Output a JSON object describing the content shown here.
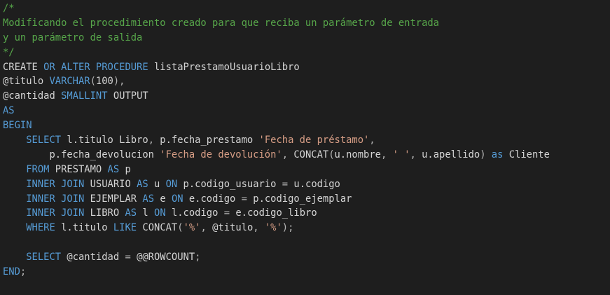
{
  "colors": {
    "background": "#1e1e1e",
    "comment": "#57a64a",
    "keyword": "#569cd6",
    "text": "#d4d4d4",
    "string": "#d69d85",
    "operator": "#b4b4b4"
  },
  "lines": [
    [
      {
        "t": "/*",
        "c": "comment"
      }
    ],
    [
      {
        "t": "Modificando el procedimiento creado para que reciba un parámetro de entrada",
        "c": "comment"
      }
    ],
    [
      {
        "t": "y un parámetro de salida",
        "c": "comment"
      }
    ],
    [
      {
        "t": "*/",
        "c": "comment"
      }
    ],
    [
      {
        "t": "CREATE ",
        "c": "text"
      },
      {
        "t": "OR ALTER PROCEDURE",
        "c": "keyword"
      },
      {
        "t": " listaPrestamoUsuarioLibro",
        "c": "text"
      }
    ],
    [
      {
        "t": "@titulo ",
        "c": "text"
      },
      {
        "t": "VARCHAR",
        "c": "keyword"
      },
      {
        "t": "(",
        "c": "op"
      },
      {
        "t": "100",
        "c": "text"
      },
      {
        "t": "),",
        "c": "op"
      }
    ],
    [
      {
        "t": "@cantidad ",
        "c": "text"
      },
      {
        "t": "SMALLINT",
        "c": "keyword"
      },
      {
        "t": " OUTPUT",
        "c": "text"
      }
    ],
    [
      {
        "t": "AS",
        "c": "keyword"
      }
    ],
    [
      {
        "t": "BEGIN",
        "c": "keyword"
      }
    ],
    [
      {
        "t": "    ",
        "c": "text"
      },
      {
        "t": "SELECT",
        "c": "keyword"
      },
      {
        "t": " l.titulo Libro",
        "c": "text"
      },
      {
        "t": ",",
        "c": "op"
      },
      {
        "t": " p.fecha_prestamo ",
        "c": "text"
      },
      {
        "t": "'Fecha de préstamo'",
        "c": "string"
      },
      {
        "t": ",",
        "c": "op"
      }
    ],
    [
      {
        "t": "        p.fecha_devolucion ",
        "c": "text"
      },
      {
        "t": "'Fecha de devolución'",
        "c": "string"
      },
      {
        "t": ",",
        "c": "op"
      },
      {
        "t": " CONCAT",
        "c": "text"
      },
      {
        "t": "(",
        "c": "op"
      },
      {
        "t": "u.nombre",
        "c": "text"
      },
      {
        "t": ",",
        "c": "op"
      },
      {
        "t": " ",
        "c": "text"
      },
      {
        "t": "' '",
        "c": "string"
      },
      {
        "t": ",",
        "c": "op"
      },
      {
        "t": " u.apellido",
        "c": "text"
      },
      {
        "t": ")",
        "c": "op"
      },
      {
        "t": " as",
        "c": "keyword"
      },
      {
        "t": " Cliente",
        "c": "text"
      }
    ],
    [
      {
        "t": "    ",
        "c": "text"
      },
      {
        "t": "FROM",
        "c": "keyword"
      },
      {
        "t": " PRESTAMO ",
        "c": "text"
      },
      {
        "t": "AS",
        "c": "keyword"
      },
      {
        "t": " p",
        "c": "text"
      }
    ],
    [
      {
        "t": "    ",
        "c": "text"
      },
      {
        "t": "INNER JOIN",
        "c": "keyword"
      },
      {
        "t": " USUARIO ",
        "c": "text"
      },
      {
        "t": "AS",
        "c": "keyword"
      },
      {
        "t": " u ",
        "c": "text"
      },
      {
        "t": "ON",
        "c": "keyword"
      },
      {
        "t": " p.codigo_usuario ",
        "c": "text"
      },
      {
        "t": "=",
        "c": "op"
      },
      {
        "t": " u.codigo",
        "c": "text"
      }
    ],
    [
      {
        "t": "    ",
        "c": "text"
      },
      {
        "t": "INNER JOIN",
        "c": "keyword"
      },
      {
        "t": " EJEMPLAR ",
        "c": "text"
      },
      {
        "t": "AS",
        "c": "keyword"
      },
      {
        "t": " e ",
        "c": "text"
      },
      {
        "t": "ON",
        "c": "keyword"
      },
      {
        "t": " e.codigo ",
        "c": "text"
      },
      {
        "t": "=",
        "c": "op"
      },
      {
        "t": " p.codigo_ejemplar",
        "c": "text"
      }
    ],
    [
      {
        "t": "    ",
        "c": "text"
      },
      {
        "t": "INNER JOIN",
        "c": "keyword"
      },
      {
        "t": " LIBRO ",
        "c": "text"
      },
      {
        "t": "AS",
        "c": "keyword"
      },
      {
        "t": " l ",
        "c": "text"
      },
      {
        "t": "ON",
        "c": "keyword"
      },
      {
        "t": " l.codigo ",
        "c": "text"
      },
      {
        "t": "=",
        "c": "op"
      },
      {
        "t": " e.codigo_libro",
        "c": "text"
      }
    ],
    [
      {
        "t": "    ",
        "c": "text"
      },
      {
        "t": "WHERE",
        "c": "keyword"
      },
      {
        "t": " l.titulo ",
        "c": "text"
      },
      {
        "t": "LIKE",
        "c": "keyword"
      },
      {
        "t": " CONCAT",
        "c": "text"
      },
      {
        "t": "(",
        "c": "op"
      },
      {
        "t": "'%'",
        "c": "string"
      },
      {
        "t": ",",
        "c": "op"
      },
      {
        "t": " @titulo",
        "c": "text"
      },
      {
        "t": ",",
        "c": "op"
      },
      {
        "t": " ",
        "c": "text"
      },
      {
        "t": "'%'",
        "c": "string"
      },
      {
        "t": ");",
        "c": "op"
      }
    ],
    [
      {
        "t": "",
        "c": "text"
      }
    ],
    [
      {
        "t": "    ",
        "c": "text"
      },
      {
        "t": "SELECT",
        "c": "keyword"
      },
      {
        "t": " @cantidad ",
        "c": "text"
      },
      {
        "t": "=",
        "c": "op"
      },
      {
        "t": " @@ROWCOUNT",
        "c": "text"
      },
      {
        "t": ";",
        "c": "op"
      }
    ],
    [
      {
        "t": "END",
        "c": "keyword"
      },
      {
        "t": ";",
        "c": "op"
      }
    ]
  ]
}
